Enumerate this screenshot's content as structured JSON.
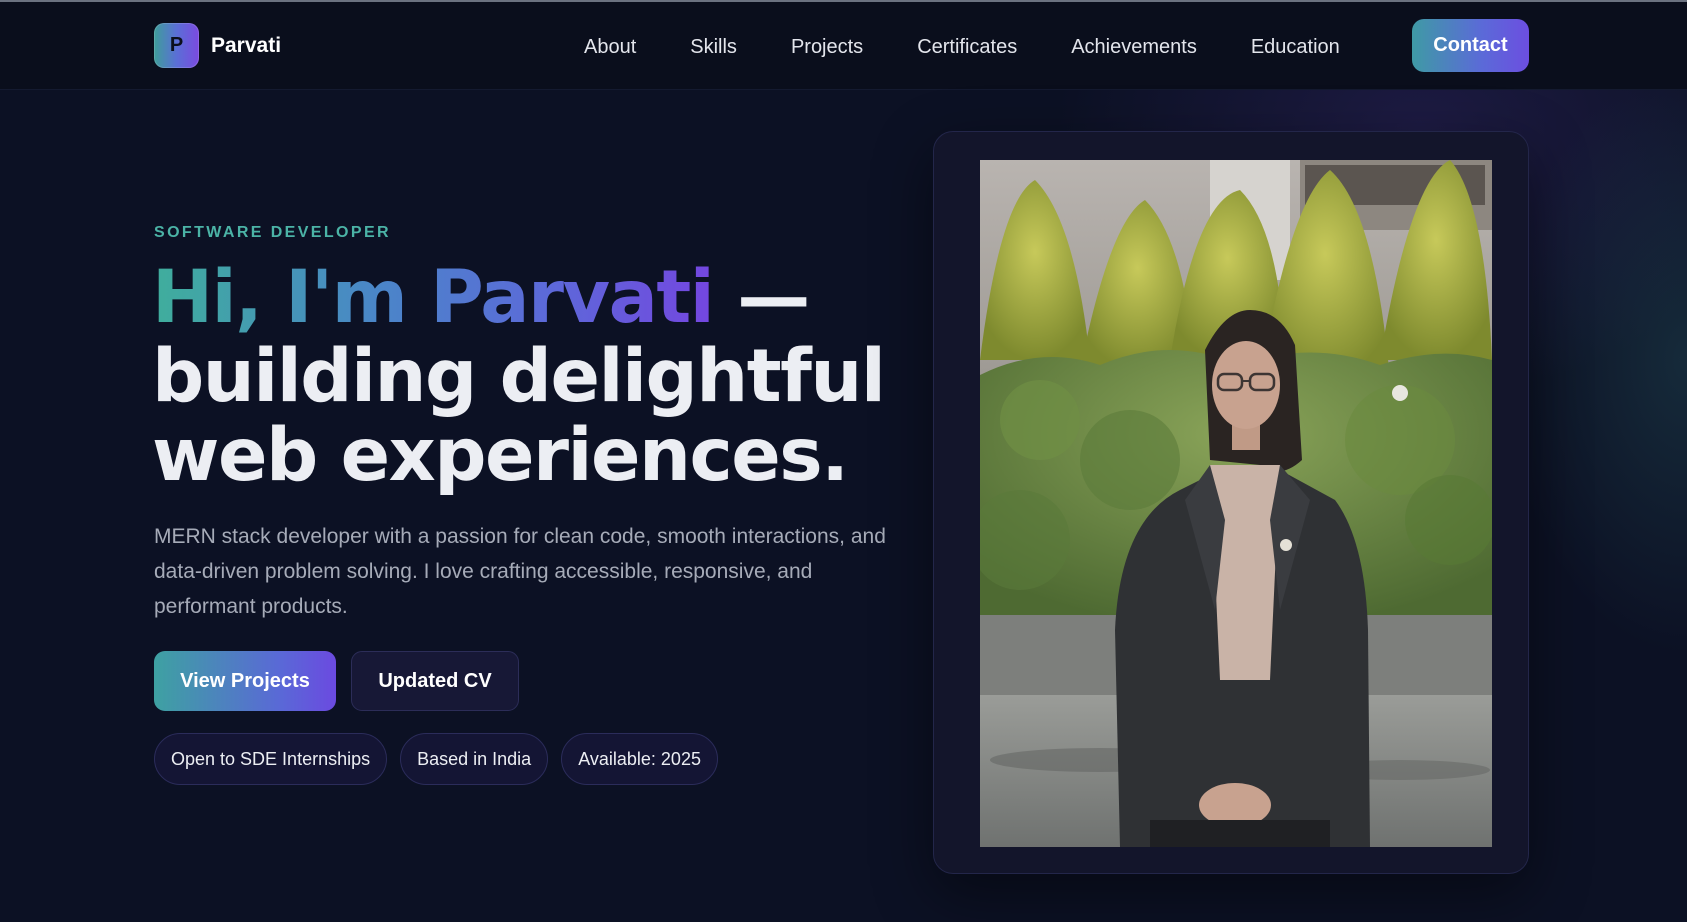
{
  "brand": {
    "logo_letter": "P",
    "name": "Parvati"
  },
  "nav": {
    "links": [
      "About",
      "Skills",
      "Projects",
      "Certificates",
      "Achievements",
      "Education"
    ],
    "contact_label": "Contact"
  },
  "hero": {
    "eyebrow": "SOFTWARE DEVELOPER",
    "headline_highlight": "Hi, I'm Parvati",
    "headline_rest": " — building delightful web experiences.",
    "description": "MERN stack developer with a passion for clean code, smooth interactions, and data-driven problem solving. I love crafting accessible, responsive, and performant products.",
    "primary_button": "View Projects",
    "secondary_button": "Updated CV",
    "badges": [
      "Open to SDE Internships",
      "Based in India",
      "Available: 2025"
    ]
  },
  "colors": {
    "background": "#0c1124",
    "navbar": "#0a0e1c",
    "accent_teal": "#4bb3a6",
    "accent_purple": "#6b4ae0",
    "text_muted": "#a6abb8"
  }
}
